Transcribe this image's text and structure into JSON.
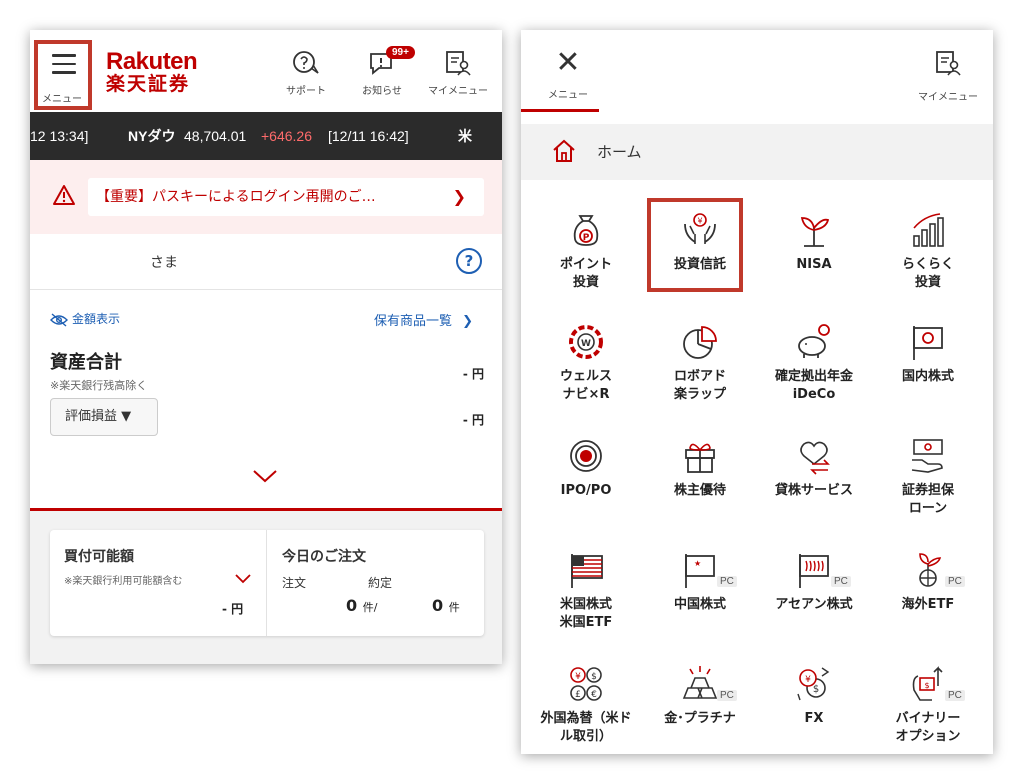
{
  "left": {
    "header": {
      "menu_label": "メニュー",
      "logo_en": "Rakuten",
      "logo_jp": "楽天証券",
      "support_label": "サポート",
      "notice_label": "お知らせ",
      "notice_badge": "99+",
      "mymenu_label": "マイメニュー"
    },
    "ticker": {
      "time1": "12 13:34]",
      "name": "NYダウ",
      "value": "48,704.01",
      "change": "+646.26",
      "time2": "[12/11 16:42]",
      "next": "米"
    },
    "alert": {
      "text": "【重要】パスキーによるログイン再開のご…"
    },
    "user": {
      "suffix": "さま",
      "help": "?"
    },
    "assets": {
      "toggle_label": "金額表示",
      "holdings_link": "保有商品一覧",
      "title": "資産合計",
      "note": "※楽天銀行残高除く",
      "total_value": "- 円",
      "pl_value": "- 円",
      "select_label": "評価損益 ▼"
    },
    "buying": {
      "title": "買付可能額",
      "note": "※楽天銀行利用可能額含む",
      "value": "- 円"
    },
    "orders": {
      "title": "今日のご注文",
      "order_label": "注文",
      "exec_label": "約定",
      "order_count": "0",
      "exec_count": "0",
      "unit": "件",
      "sep": "/"
    }
  },
  "right": {
    "close_label": "メニュー",
    "mymenu_label": "マイメニュー",
    "home_label": "ホーム",
    "pc_tag": "PC",
    "tiles": [
      {
        "label": "ポイント\n投資",
        "icon": "point-bag-icon"
      },
      {
        "label": "投資信託",
        "icon": "fund-hands-icon",
        "highlight": true
      },
      {
        "label": "NISA",
        "icon": "sprout-icon"
      },
      {
        "label": "らくらく\n投資",
        "icon": "growth-bars-icon"
      },
      {
        "label": "ウェルス\nナビ×R",
        "icon": "wealthnavi-icon"
      },
      {
        "label": "ロボアド\n楽ラップ",
        "icon": "pie-chart-icon"
      },
      {
        "label": "確定拠出年金\niDeCo",
        "icon": "piggy-bank-icon"
      },
      {
        "label": "国内株式",
        "icon": "japan-flag-icon"
      },
      {
        "label": "IPO/PO",
        "icon": "target-icon"
      },
      {
        "label": "株主優待",
        "icon": "gift-icon"
      },
      {
        "label": "貸株サービス",
        "icon": "lending-icon"
      },
      {
        "label": "証券担保\nローン",
        "icon": "loan-icon"
      },
      {
        "label": "米国株式\n米国ETF",
        "icon": "us-flag-icon"
      },
      {
        "label": "中国株式",
        "icon": "china-flag-icon",
        "pc": true
      },
      {
        "label": "アセアン株式",
        "icon": "asean-flag-icon",
        "pc": true
      },
      {
        "label": "海外ETF",
        "icon": "globe-sprout-icon",
        "pc": true
      },
      {
        "label": "外国為替（米ド\nル取引）",
        "icon": "currency-icon"
      },
      {
        "label": "金･プラチナ",
        "icon": "gold-bars-icon",
        "pc": true
      },
      {
        "label": "FX",
        "icon": "fx-icon"
      },
      {
        "label": "バイナリー\nオプション",
        "icon": "binary-option-icon",
        "pc": true
      }
    ]
  }
}
